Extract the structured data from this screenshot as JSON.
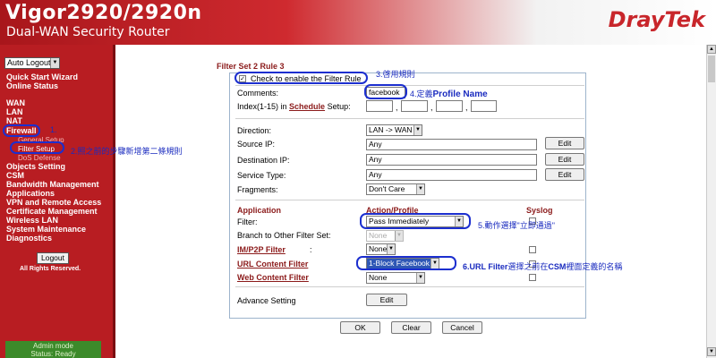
{
  "header": {
    "model": "Vigor2920/2920n",
    "subtitle": "Dual-WAN Security Router",
    "brand": "DrayTek"
  },
  "sidebar": {
    "auto_logout": "Auto Logout",
    "items": [
      "Quick Start Wizard",
      "Online Status",
      "WAN",
      "LAN",
      "NAT",
      "Firewall"
    ],
    "firewall_sub": [
      "General Setup",
      "Filter Setup",
      "DoS Defense"
    ],
    "items2": [
      "Objects Setting",
      "CSM",
      "Bandwidth Management",
      "Applications",
      "VPN and Remote Access",
      "Certificate Management",
      "Wireless LAN",
      "System Maintenance",
      "Diagnostics"
    ],
    "logout": "Logout",
    "rights": "All Rights Reserved.",
    "status1": "Admin mode",
    "status2": "Status: Ready"
  },
  "page": {
    "title": "Filter Set 2 Rule 3",
    "enable_label": "Check to enable the Filter Rule",
    "comments_label": "Comments:",
    "comments_value": "facebook",
    "index_label_pre": "Index(1-15) in",
    "index_link": "Schedule",
    "index_label_post": "Setup:",
    "direction_label": "Direction:",
    "direction_value": "LAN -> WAN",
    "source_ip_label": "Source IP:",
    "source_ip_value": "Any",
    "dest_ip_label": "Destination IP:",
    "dest_ip_value": "Any",
    "service_label": "Service Type:",
    "service_value": "Any",
    "fragments_label": "Fragments:",
    "fragments_value": "Don't Care",
    "edit": "Edit",
    "col_application": "Application",
    "col_action": "Action/Profile",
    "col_syslog": "Syslog",
    "filter_label": "Filter:",
    "filter_value": "Pass Immediately",
    "branch_label": "Branch to Other Filter Set:",
    "branch_value": "None",
    "im_label": "IM/P2P Filter",
    "im_value": "None",
    "url_label": "URL Content Filter",
    "url_value": "1-Block Facebook",
    "web_label": "Web Content Filter",
    "web_value": "None",
    "advance_label": "Advance Setting",
    "ok": "OK",
    "clear": "Clear",
    "cancel": "Cancel"
  },
  "annotations": {
    "a1": "1.",
    "a2": "2.照之前的步驟新增第二條規則",
    "a3": "3.啓用規則",
    "a4_prefix": "4.定義",
    "a4_bold": "Profile Name",
    "a5": "5.動作選擇\"立即通過\"",
    "a6_prefix": "6.URL Filter",
    "a6_mid": "選擇之前在",
    "a6_csm": "CSM",
    "a6_suffix": "裡面定義的名稱"
  }
}
